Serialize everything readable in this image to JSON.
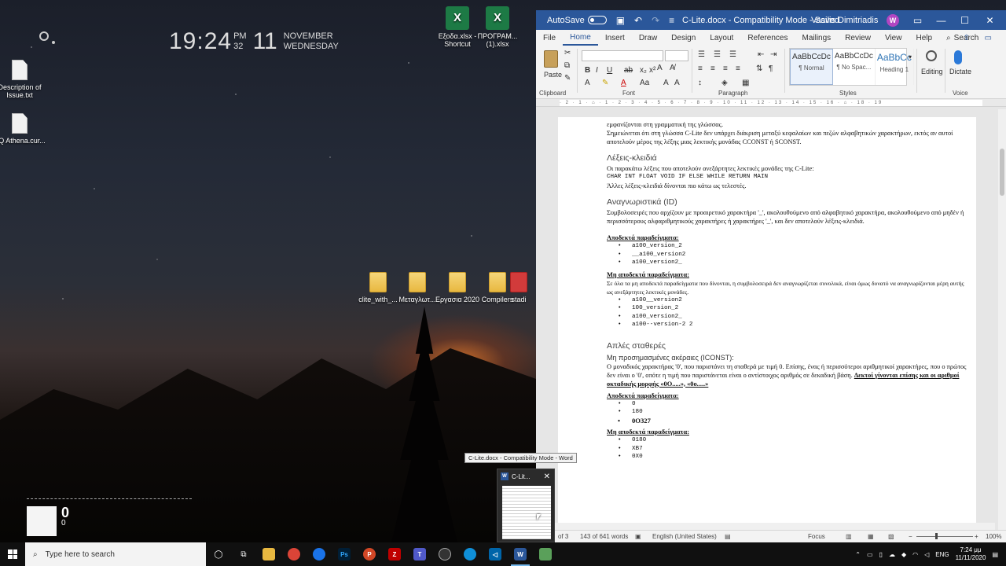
{
  "desktop": {
    "clock": {
      "time": "19:24",
      "ampm": "PM",
      "seconds": "32",
      "day": "11",
      "month": "NOVEMBER",
      "weekday": "WEDNESDAY"
    },
    "icons": [
      {
        "label": "Description of Issue.txt",
        "type": "txt"
      },
      {
        "label": "SQ Athena.cur...",
        "type": "txt"
      },
      {
        "label": "Εξοδα.xlsx - Shortcut",
        "type": "excel"
      },
      {
        "label": "ΠΡΟΓΡΑΜ... (1).xlsx",
        "type": "excel"
      },
      {
        "label": "clite_with_...",
        "type": "folder"
      },
      {
        "label": "Μεταγλωτ...",
        "type": "folder"
      },
      {
        "label": "Εργασια 2020",
        "type": "folder"
      },
      {
        "label": "Compilers",
        "type": "folder"
      },
      {
        "label": "stadi",
        "type": "folder"
      }
    ],
    "widget": {
      "value1": "0",
      "value2": "0"
    }
  },
  "word": {
    "autosave_label": "AutoSave",
    "autosave_state": "Off",
    "title": "C-Lite.docx  -  Compatibility Mode  -  Saved",
    "user": "Vasilis Dimitriadis",
    "user_initial": "W",
    "menu_tabs": [
      "File",
      "Home",
      "Insert",
      "Draw",
      "Design",
      "Layout",
      "References",
      "Mailings",
      "Review",
      "View",
      "Help"
    ],
    "search_label": "Search",
    "ribbon": {
      "paste": "Paste",
      "groups": {
        "clipboard": "Clipboard",
        "font": "Font",
        "paragraph": "Paragraph",
        "styles": "Styles",
        "voice": "Voice"
      },
      "styles": [
        {
          "preview": "AaBbCcDc",
          "name": "¶ Normal"
        },
        {
          "preview": "AaBbCcDc",
          "name": "¶ No Spac..."
        },
        {
          "preview": "AaBbCc",
          "name": "Heading 1"
        }
      ],
      "editing": "Editing",
      "dictate": "Dictate"
    },
    "ruler_text": "· 2 · 1 · ⌂ · 1 · 2 · 3 · 4 · 5 · 6 · 7 · 8 · 9 · 10 · 11 · 12 · 13 · 14 · 15 · 16 · ⌂ · 18 · 19",
    "doc": {
      "line_top1": "εμφανίζονται στη γραμματική της γλώσσας.",
      "line_top2": "Σημειώνεται ότι στη γλώσσα C-Lite δεν υπάρχει διάκριση μεταξύ κεφαλαίων και πεζών αλφαβητικών χαρακτήρων, εκτός αν αυτοί αποτελούν μέρος της λέξης μιας λεκτικής μονάδας CCONST ή SCONST.",
      "h_keywords": "Λέξεις-κλειδιά",
      "kw_intro": "Οι παρακάτω λέξεις που αποτελούν ανεξάρτητες λεκτικές μονάδες της C-Lite:",
      "kw_list": "CHAR INT FLOAT VOID IF ELSE WHILE RETURN MAIN",
      "kw_more": "Άλλες λέξεις-κλειδιά δίνονται πιο κάτω ως τελεστές.",
      "h_identifiers": "Αναγνωριστικά (ID)",
      "id_desc": "Συμβολοσειρές που αρχίζουν με προαιρετικό χαρακτήρα '_', ακολουθούμενο από αλφαβητικό χαρακτήρα, ακολουθούμενο από μηδέν ή περισσότερους αλφαριθμητικούς χαρακτήρες ή χαρακτήρες '_', και δεν αποτελούν λέξεις-κλειδιά.",
      "accepted_label": "Αποδεκτά παραδείγματα:",
      "id_accepted": [
        "a100_version_2",
        "__a100_version2",
        "a100_version2_"
      ],
      "rejected_label": "Μη αποδεκτά παραδείγματα:",
      "id_rejected_note": "Σε όλα τα μη αποδεκτά παραδείγματα που δίνονται, η συμβολοσειρά δεν αναγνωρίζεται συνολικά, είναι όμως δυνατό να αναγνωρίζονται μέρη αυτής ως ανεξάρτητες λεκτικές μονάδες.",
      "id_rejected": [
        "a100__version2",
        "100_version_2",
        "a100_version2_",
        "a100--version-2 2"
      ],
      "h_constants": "Απλές σταθερές",
      "sub_iconst": "Μη προσημασμένες ακέραιες (ICONST):",
      "iconst_desc": "Ο μοναδικός χαρακτήρας '0', που παριστάνει τη σταθερά με τιμή 0. Επίσης, ένας ή περισσότεροι αριθμητικοί χαρακτήρες, που ο πρώτος δεν είναι ο '0', οπότε η τιμή που παριστάνεται είναι ο αντίστοιχος αριθμός σε δεκαδική βάση.",
      "iconst_bold": "Δεκτοί γίνονται επίσης και οι αριθμοί οκταδικής μορφής «0O.....», «0o.....»",
      "iconst_accepted": [
        "0",
        "180"
      ],
      "iconst_accepted_bold": "0O327",
      "iconst_rejected": [
        "0180",
        "XB7",
        "0X0"
      ]
    },
    "status": {
      "page": "of 3",
      "words": "143 of 641 words",
      "language": "English (United States)",
      "focus": "Focus",
      "zoom": "100%"
    }
  },
  "tooltip": "C-Lite.docx  -  Compatibility Mode - Word",
  "thumbnail": {
    "title": "C-Lit..."
  },
  "taskbar": {
    "search_placeholder": "Type here to search",
    "language": "ENG",
    "time": "7:24 μμ",
    "date": "11/11/2020"
  }
}
